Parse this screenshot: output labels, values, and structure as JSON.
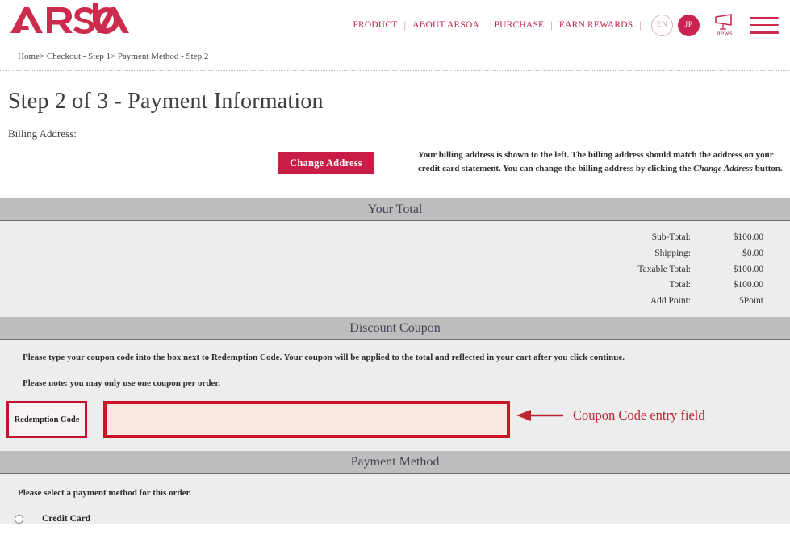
{
  "header": {
    "logo_text": "ARSOA",
    "nav_items": [
      {
        "label": "PRODUCT"
      },
      {
        "label": "ABOUT ARSOA"
      },
      {
        "label": "PURCHASE"
      },
      {
        "label": "EARN REWARDS"
      }
    ],
    "separator": "|",
    "lang_en": "EN",
    "lang_jp": "JP",
    "news_label": "news",
    "brand_color": "#cc2b4e"
  },
  "breadcrumb": {
    "text": "Home> Checkout - Step 1> Payment Method - Step 2"
  },
  "page": {
    "title": "Step 2 of 3 - Payment Information",
    "billing_address_label": "Billing Address:",
    "change_address_button": "Change Address",
    "billing_note_part1": "Your billing address is shown to the left. The billing address should match the address on your credit card statement. You can change the billing address by clicking the ",
    "billing_note_emphasis": "Change Address",
    "billing_note_part2": " button."
  },
  "your_total": {
    "heading": "Your Total",
    "rows": [
      {
        "label": "Sub-Total:",
        "value": "$100.00"
      },
      {
        "label": "Shipping:",
        "value": "$0.00"
      },
      {
        "label": "Taxable Total:",
        "value": "$100.00"
      },
      {
        "label": "Total:",
        "value": "$100.00"
      },
      {
        "label": "Add Point:",
        "value": "5Point"
      }
    ]
  },
  "discount_coupon": {
    "heading": "Discount Coupon",
    "instruction": "Please type your coupon code into the box next to Redemption Code. Your coupon will be applied to the total and reflected in your cart after you click continue.",
    "note": "Please note: you may only use one coupon per order.",
    "redemption_label": "Redemption Code",
    "redemption_value": "",
    "redemption_placeholder": "",
    "annotation_text": "Coupon Code entry field",
    "annotation_color": "#bb2433",
    "highlight_border_color": "#ce1226",
    "highlight_fill_color": "#f9e7e2"
  },
  "payment_method": {
    "heading": "Payment Method",
    "instruction": "Please select a payment method for this order.",
    "options": [
      {
        "label": "Credit Card",
        "selected": false
      }
    ]
  }
}
